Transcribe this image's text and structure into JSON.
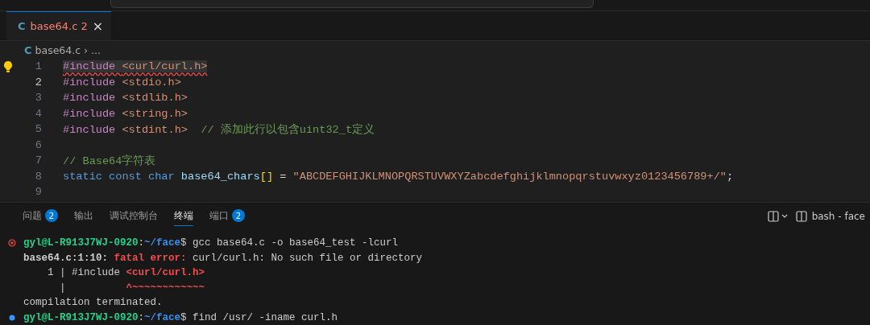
{
  "editor_tabs": [
    {
      "file_icon": "C",
      "label": "base64.c 2",
      "close": "×",
      "selected": true,
      "has_errors": true
    }
  ],
  "breadcrumb": {
    "file_icon": "C",
    "file": "base64.c",
    "separator": "›",
    "more": "..."
  },
  "code_lines": [
    {
      "number": "1",
      "current": false,
      "error": true,
      "lightbulb": true,
      "tokens": [
        {
          "kind": "directive",
          "text": "#include "
        },
        {
          "kind": "string",
          "text": "<curl/curl.h>"
        }
      ]
    },
    {
      "number": "2",
      "current": true,
      "error": false,
      "lightbulb": false,
      "tokens": [
        {
          "kind": "directive",
          "text": "#include "
        },
        {
          "kind": "string",
          "text": "<stdio.h>"
        }
      ]
    },
    {
      "number": "3",
      "current": false,
      "error": false,
      "lightbulb": false,
      "tokens": [
        {
          "kind": "directive",
          "text": "#include "
        },
        {
          "kind": "string",
          "text": "<stdlib.h>"
        }
      ]
    },
    {
      "number": "4",
      "current": false,
      "error": false,
      "lightbulb": false,
      "tokens": [
        {
          "kind": "directive",
          "text": "#include "
        },
        {
          "kind": "string",
          "text": "<string.h>"
        }
      ]
    },
    {
      "number": "5",
      "current": false,
      "error": false,
      "lightbulb": false,
      "tokens": [
        {
          "kind": "directive",
          "text": "#include "
        },
        {
          "kind": "string",
          "text": "<stdint.h>"
        },
        {
          "kind": "trailing_comment",
          "text": "// 添加此行以包含uint32_t定义"
        }
      ]
    },
    {
      "number": "6",
      "current": false,
      "error": false,
      "lightbulb": false
    },
    {
      "number": "7",
      "current": false,
      "error": false,
      "lightbulb": false,
      "tokens": [
        {
          "kind": "comment",
          "text": "// Base64字符表"
        }
      ]
    },
    {
      "number": "8",
      "current": false,
      "error": false,
      "lightbulb": false,
      "tokens": [
        {
          "kind": "keyword",
          "text": "static const char "
        },
        {
          "kind": "variable",
          "text": "base64_chars"
        },
        {
          "kind": "bracket",
          "text": "[]"
        },
        {
          "kind": "plain",
          "text": " = "
        },
        {
          "kind": "string",
          "text": "\"ABCDEFGHIJKLMNOPQRSTUVWXYZabcdefghijklmnopqrstuvwxyz0123456789+/\""
        },
        {
          "kind": "plain",
          "text": ";"
        }
      ]
    },
    {
      "number": "9",
      "current": false,
      "error": false,
      "lightbulb": false
    }
  ],
  "panel_tabs": [
    {
      "label": "问题",
      "badge": "2",
      "selected": false
    },
    {
      "label": "输出",
      "selected": false
    },
    {
      "label": "调试控制台",
      "selected": false
    },
    {
      "label": "终端",
      "selected": true
    },
    {
      "label": "端口",
      "badge": "2",
      "selected": false
    }
  ],
  "terminal_name": "bash - face",
  "terminal_lines": [
    {
      "command": true,
      "failed": true,
      "spans": [
        {
          "kind": "user",
          "text": "gyl@L-R913J7WJ-0920"
        },
        {
          "kind": "plain",
          "text": ":"
        },
        {
          "kind": "path",
          "text": "~/face"
        },
        {
          "kind": "plain",
          "text": "$ gcc base64.c -o base64_test -lcurl"
        }
      ]
    },
    {
      "command": false,
      "spans": [
        {
          "kind": "bold",
          "text": "base64.c:1:10: "
        },
        {
          "kind": "error",
          "text": "fatal error: "
        },
        {
          "kind": "plain",
          "text": "curl/curl.h: No such file or directory"
        }
      ]
    },
    {
      "command": false,
      "spans": [
        {
          "kind": "plain",
          "text": "    1 | #include "
        },
        {
          "kind": "error",
          "text": "<curl/curl.h>"
        }
      ]
    },
    {
      "command": false,
      "spans": [
        {
          "kind": "plain",
          "text": "      |          "
        },
        {
          "kind": "error",
          "text": "^~~~~~~~~~~~~"
        }
      ]
    },
    {
      "command": false,
      "spans": [
        {
          "kind": "plain",
          "text": "compilation terminated."
        }
      ]
    },
    {
      "command": true,
      "failed": false,
      "spans": [
        {
          "kind": "user",
          "text": "gyl@L-R913J7WJ-0920"
        },
        {
          "kind": "plain",
          "text": ":"
        },
        {
          "kind": "path",
          "text": "~/face"
        },
        {
          "kind": "plain",
          "text": "$ find /usr/ -iname curl.h"
        }
      ]
    }
  ]
}
